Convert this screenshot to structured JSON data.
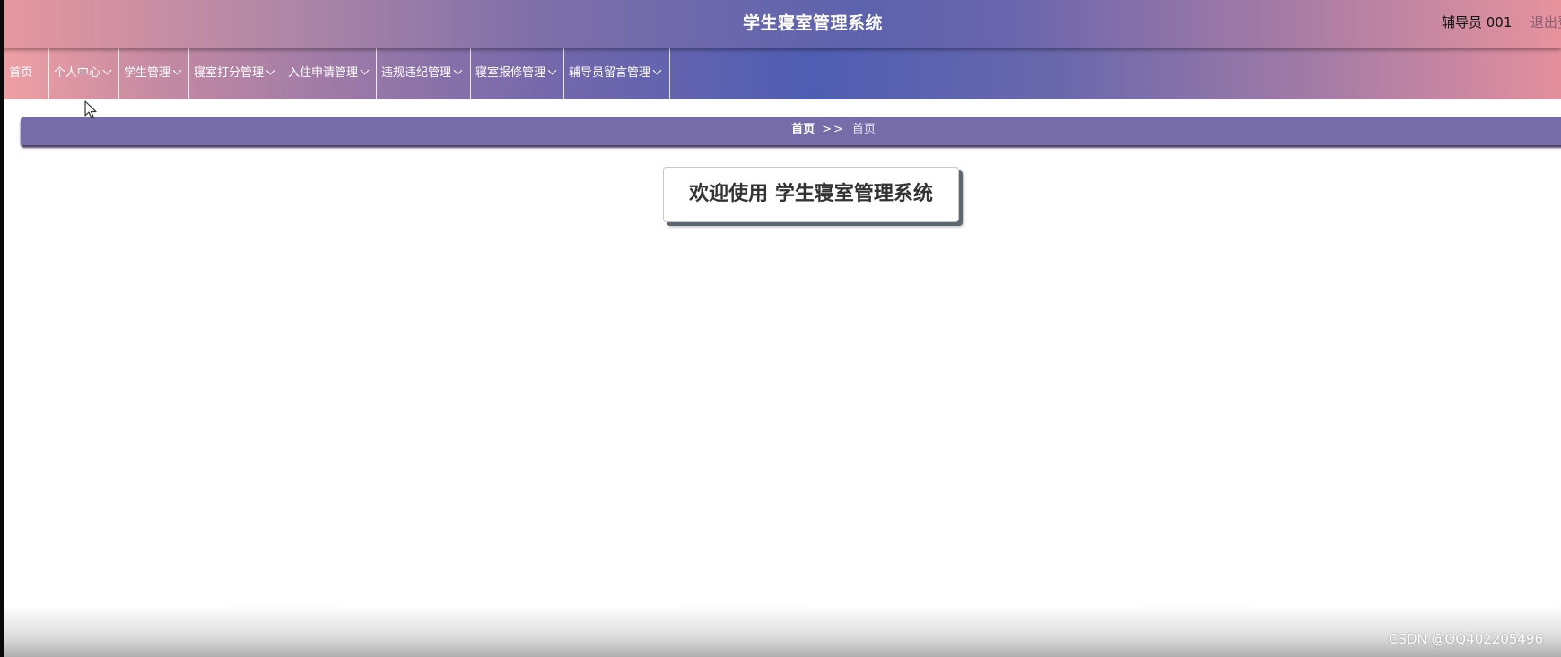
{
  "header": {
    "title": "学生寝室管理系统",
    "user": "辅导员 001",
    "logout": "退出登录"
  },
  "nav": {
    "items": [
      {
        "label": "首页",
        "dropdown": false
      },
      {
        "label": "个人中心",
        "dropdown": true
      },
      {
        "label": "学生管理",
        "dropdown": true
      },
      {
        "label": "寝室打分管理",
        "dropdown": true
      },
      {
        "label": "入住申请管理",
        "dropdown": true
      },
      {
        "label": "违规违纪管理",
        "dropdown": true
      },
      {
        "label": "寝室报修管理",
        "dropdown": true
      },
      {
        "label": "辅导员留言管理",
        "dropdown": true
      }
    ]
  },
  "breadcrumb": {
    "home": "首页",
    "separator": ">>",
    "current": "首页"
  },
  "main": {
    "welcome": "欢迎使用 学生寝室管理系统"
  },
  "watermark": "CSDN @QQ402205496",
  "colors": {
    "breadcrumb_bg": "#756ca8",
    "nav_center": "#4f5db2",
    "nav_edge": "#f0a0a4"
  }
}
